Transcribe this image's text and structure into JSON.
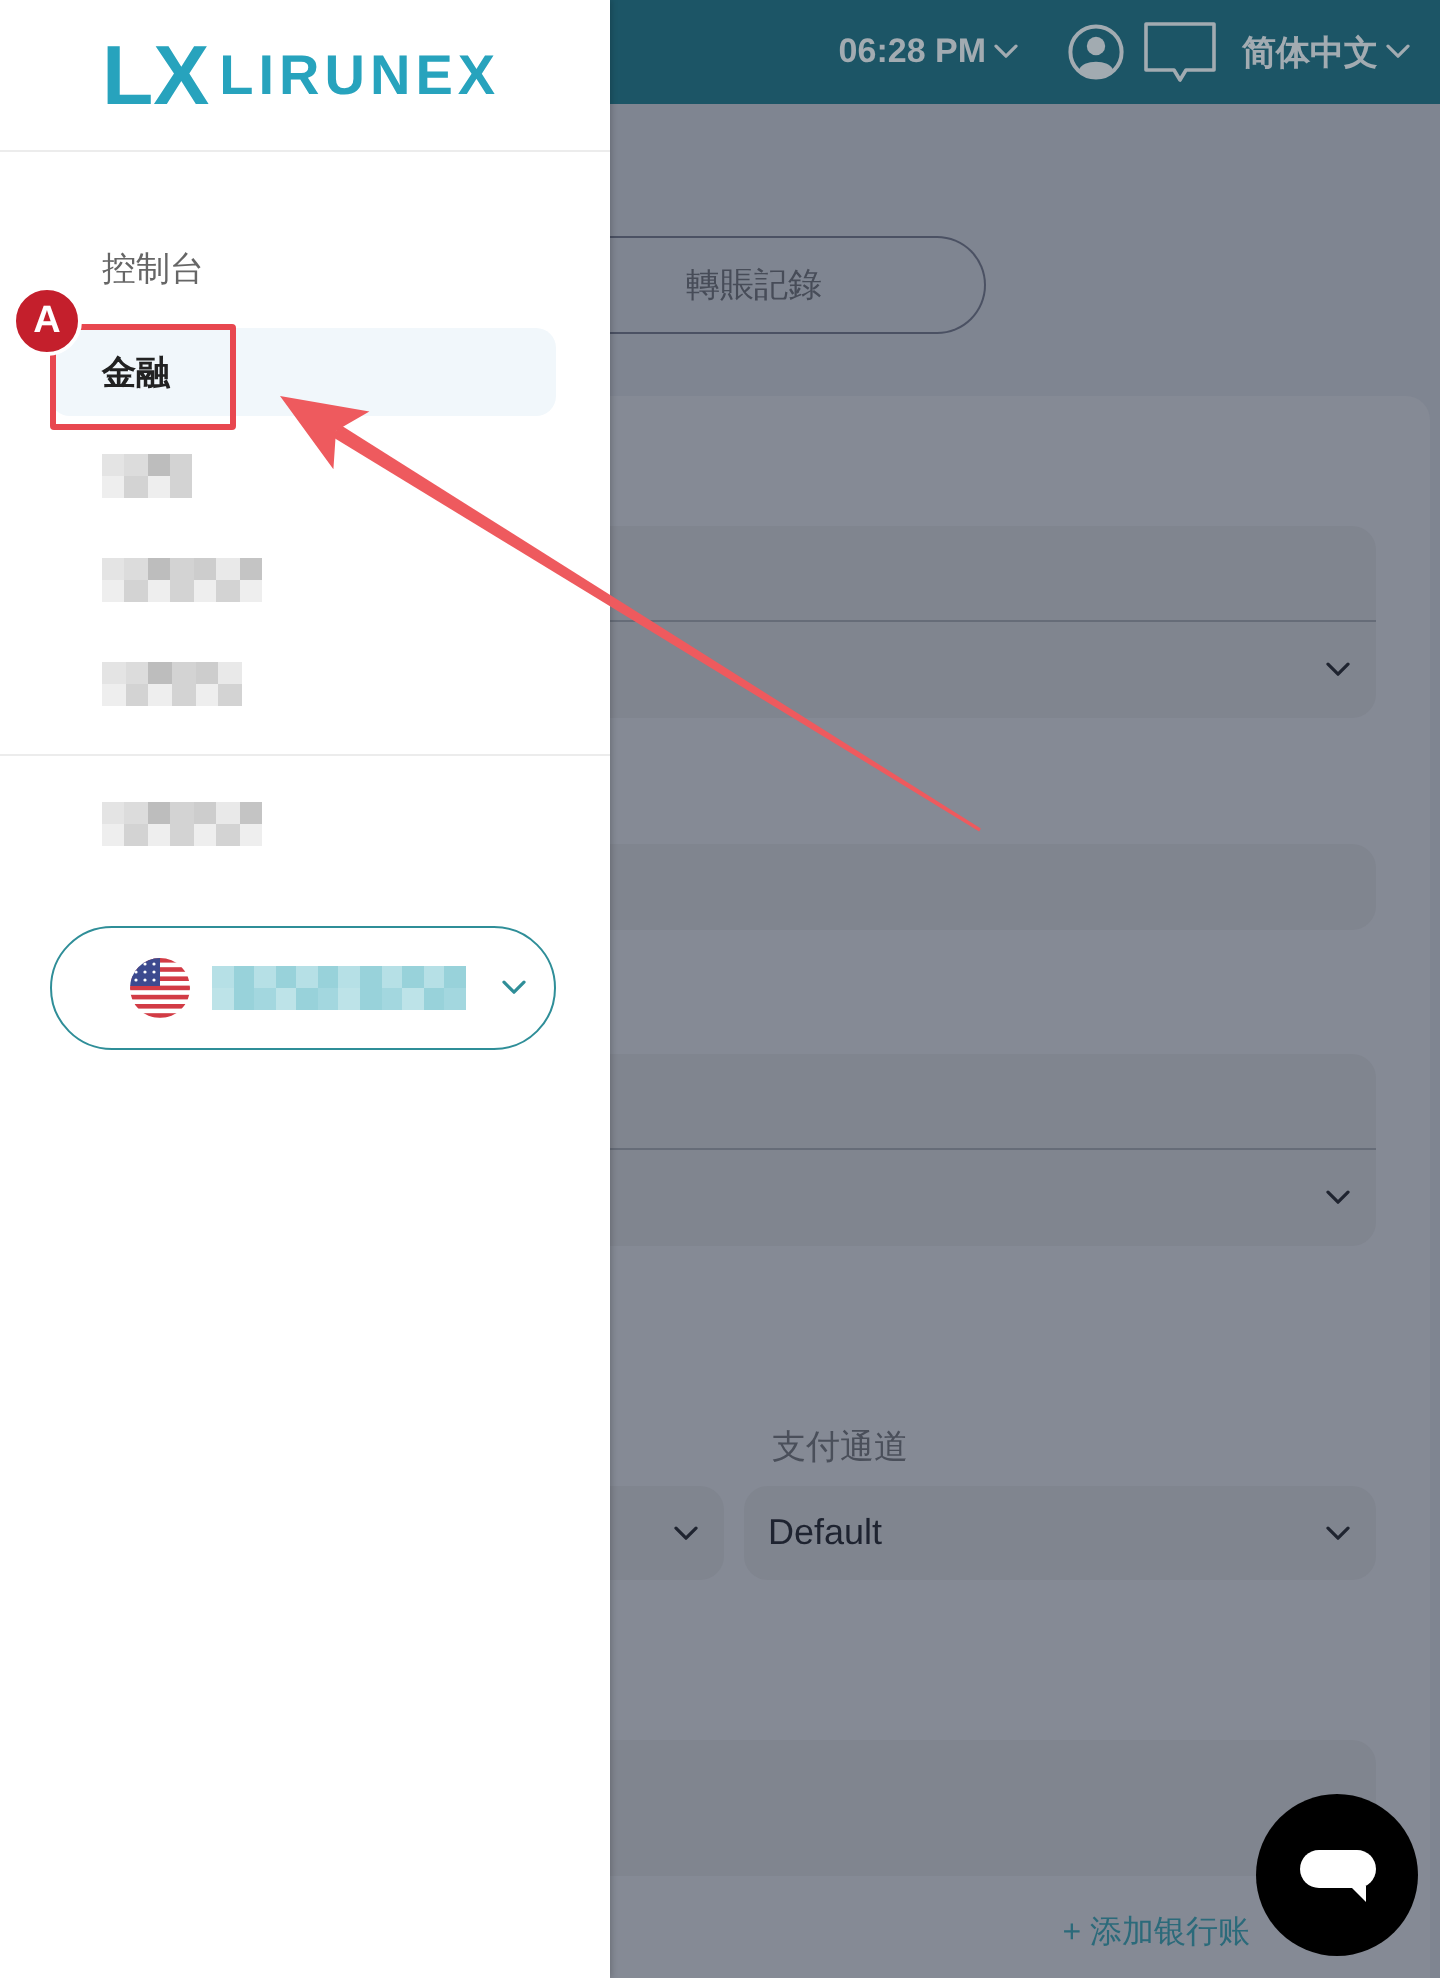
{
  "header": {
    "time": "06:28 PM",
    "language": "简体中文"
  },
  "sidebar": {
    "logo": {
      "mark": "LX",
      "name": "LIRUNEX"
    },
    "items": [
      {
        "kind": "text",
        "label": "控制台",
        "selected": false
      },
      {
        "kind": "text",
        "label": "金融",
        "selected": true
      },
      {
        "kind": "redacted",
        "selected": false
      },
      {
        "kind": "redacted",
        "selected": false
      },
      {
        "kind": "redacted",
        "selected": false
      }
    ],
    "secondary_items": [
      {
        "kind": "redacted",
        "selected": false
      }
    ],
    "account_select": {
      "redacted": true
    }
  },
  "annotation": {
    "badge": "A"
  },
  "main": {
    "tabs": [
      {
        "label": "轉賬記錄",
        "selected": false
      }
    ],
    "fields": [
      {
        "kind": "split_select"
      },
      {
        "kind": "input"
      },
      {
        "kind": "split_select"
      },
      {
        "kind": "select_pair",
        "label": "支付通道",
        "value": "Default"
      },
      {
        "kind": "input"
      }
    ],
    "link": "+ 添加银行账"
  }
}
